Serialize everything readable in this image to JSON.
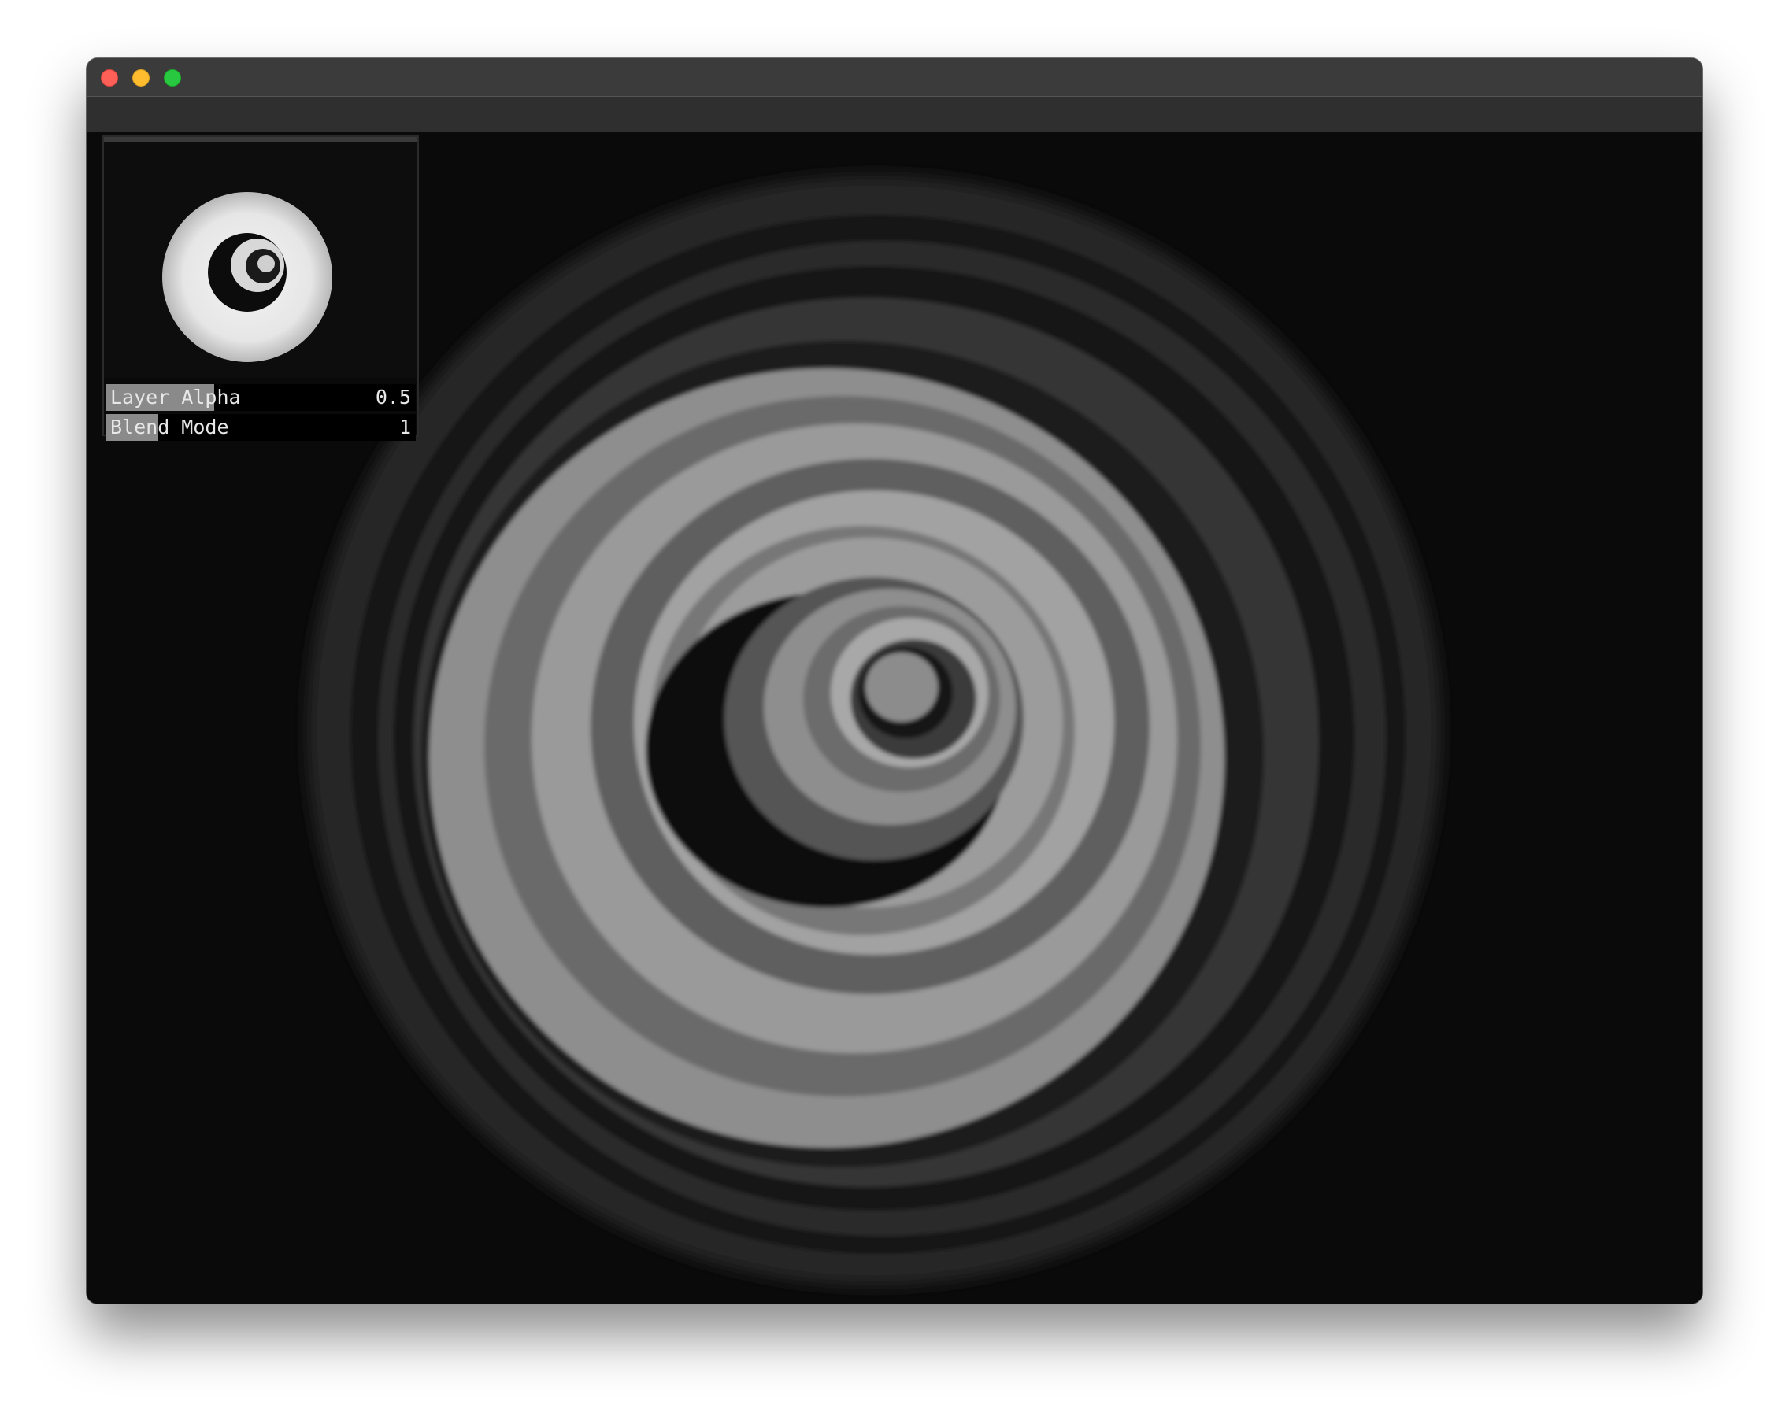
{
  "window": {
    "traffic_lights": {
      "close_color": "#fe5f57",
      "minimize_color": "#febc2e",
      "zoom_color": "#28c840"
    }
  },
  "canvas": {
    "content": "rotating concentric spiral video frame (grayscale)"
  },
  "layer_panel": {
    "params": [
      {
        "label": "Layer Alpha",
        "value": "0.5",
        "fill_fraction": 0.35
      },
      {
        "label": "Blend Mode",
        "value": "1",
        "fill_fraction": 0.17
      }
    ]
  }
}
